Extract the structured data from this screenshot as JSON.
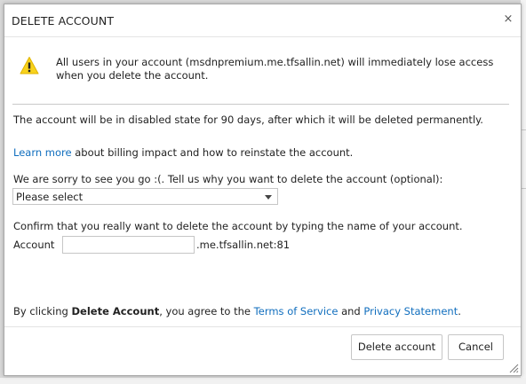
{
  "dialog": {
    "title": "DELETE ACCOUNT",
    "close_icon": "×",
    "warning": {
      "icon": "warning-triangle-icon",
      "text": "All users in your account (msdnpremium.me.tfsallin.net) will immediately lose access when you delete the account."
    },
    "disabled_notice": "The account will be in disabled state for 90 days, after which it will be deleted permanently.",
    "learn_more": {
      "link_text": "Learn more",
      "rest": " about billing impact and how to reinstate the account."
    },
    "reason": {
      "prompt": "We are sorry to see you go :(. Tell us why you want to delete the account (optional):",
      "selected": "Please select"
    },
    "confirm": {
      "prompt": "Confirm that you really want to delete the account by typing the name of your account.",
      "label": "Account",
      "value": "",
      "suffix": ".me.tfsallin.net:81"
    },
    "agreement": {
      "prefix": "By clicking ",
      "bold": "Delete Account",
      "middle": ", you agree to the ",
      "tos": "Terms of Service",
      "and": " and ",
      "privacy": "Privacy Statement",
      "end": "."
    },
    "buttons": {
      "delete": "Delete account",
      "cancel": "Cancel"
    }
  },
  "colors": {
    "link": "#106ebe",
    "warning_yellow": "#f8d21c"
  }
}
